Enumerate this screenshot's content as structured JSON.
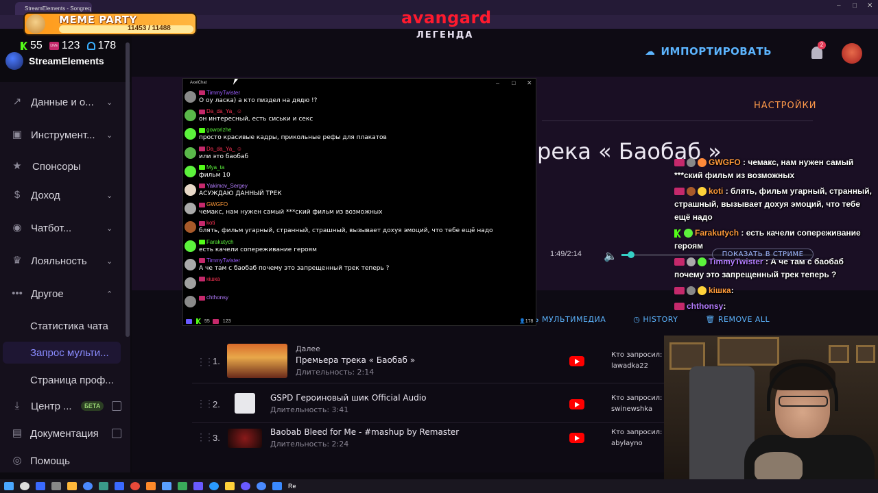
{
  "browser": {
    "tab_title": "StreamElements - Songreq"
  },
  "overlay_top": {
    "meme_title": "MEME PARTY",
    "meme_count": "11453 / 11488",
    "meme_progress": 0.997,
    "avangard": "avangard",
    "legenda": "ЛЕГЕНДА"
  },
  "stats": {
    "kick": "55",
    "live": "123",
    "viewers": "178"
  },
  "brand": {
    "name": "StreamElements"
  },
  "sidebar": {
    "items": [
      {
        "label": "Данные и о...",
        "icon": "chart-icon"
      },
      {
        "label": "Инструмент...",
        "icon": "tools-icon"
      },
      {
        "label": "Спонсоры",
        "icon": "star-icon"
      },
      {
        "label": "Доход",
        "icon": "dollar-icon"
      },
      {
        "label": "Чатбот...",
        "icon": "chatbot-icon"
      },
      {
        "label": "Лояльность",
        "icon": "loyalty-icon"
      },
      {
        "label": "Другое",
        "icon": "more-icon"
      }
    ],
    "sub": [
      "Статистика чата",
      "Запрос мульти...",
      "Страница проф..."
    ],
    "center": "Центр ...",
    "beta": "БЕТА",
    "docs": "Документация",
    "help": "Помощь"
  },
  "header": {
    "import": "ИМПОРТИРОВАТЬ",
    "bell_count": "2"
  },
  "player": {
    "settings": "НАСТРОЙКИ",
    "title": "река « Баобаб »",
    "time": "1:49/2:14",
    "volume": 0.05,
    "show_stream": "ПОКАЗАТЬ В СТРИМЕ",
    "actions": [
      "ИТЬ МУЛЬТИМЕДИА",
      "HISTORY",
      "REMOVE ALL"
    ]
  },
  "queue": [
    {
      "num": "1.",
      "next": "Далее",
      "title": "Премьера трека « Баобаб »",
      "duration": "Длительность: 2:14",
      "who_label": "Кто запросил:",
      "who": "lawadka22"
    },
    {
      "num": "2.",
      "next": "",
      "title": "GSPD Героиновый шик Official Audio",
      "duration": "Длительность: 3:41",
      "who_label": "Кто запросил:",
      "who": "swinewshka"
    },
    {
      "num": "3.",
      "next": "",
      "title": "Baobab Bleed for Me - #mashup by Remaster",
      "duration": "Длительность: 2:24",
      "who_label": "Кто запросил:",
      "who": "abylayno"
    }
  ],
  "right_chat": [
    {
      "name": "GWGFO",
      "text": ": чемакс, нам нужен самый ***ский фильм из возможных"
    },
    {
      "name": "koti",
      "text": ": блять, фильм угарный, странный, страшный, вызывает дохуя эмоций, что тебе ещё надо"
    },
    {
      "name": "Farakutych",
      "text": ": есть качели сопереживание героям"
    },
    {
      "name": "TimmyTwister",
      "text": ": А че там с баобаб почему это запрещенный трек теперь ?"
    },
    {
      "name": "kішка",
      "text": ":"
    },
    {
      "name": "chthonsy",
      "text": ":"
    }
  ],
  "axelchat": {
    "title": "AxelChat",
    "messages": [
      {
        "name": "TimmyTwister",
        "text": "О оу ласка) а кто пиздел на дядю !?",
        "color": "#9b5cff"
      },
      {
        "name": "Da_da_Ya_ ☺",
        "text": "он интересный, есть сиськи и секс",
        "color": "#ff3355"
      },
      {
        "name": "goworizhe",
        "text": "просто красивые кадры, прикольные рефы для плакатов",
        "color": "#5cf23c"
      },
      {
        "name": "Da_da_Ya_ ☺",
        "text": "или это баобаб",
        "color": "#ff3355"
      },
      {
        "name": "Mya_ta",
        "text": "фильм 10",
        "color": "#5cf23c"
      },
      {
        "name": "Yakimov_Sergey",
        "text": "АСУЖДАЮ ДАННЫЙ ТРЕК",
        "color": "#b47cff"
      },
      {
        "name": "GWGFO",
        "text": "чемакс, нам нужен самый ***ский фильм из возможных",
        "color": "#ff9a3a"
      },
      {
        "name": "koti",
        "text": "блять, фильм угарный, странный, страшный, вызывает дохуя эмоций, что тебе ещё надо",
        "color": "#ff3355"
      },
      {
        "name": "Farakutych",
        "text": "есть качели сопереживание героям",
        "color": "#5cf23c"
      },
      {
        "name": "TimmyTwister",
        "text": "А че там с баобаб почему это запрещенный трек теперь ?",
        "color": "#9b5cff"
      },
      {
        "name": "кішка",
        "text": "",
        "color": "#ff3355"
      },
      {
        "name": "chthonsy",
        "text": "",
        "color": "#b47cff"
      }
    ],
    "foot_kick": "55",
    "foot_live": "123",
    "foot_viewers": "178"
  },
  "taskbar": {
    "re": "Re"
  }
}
